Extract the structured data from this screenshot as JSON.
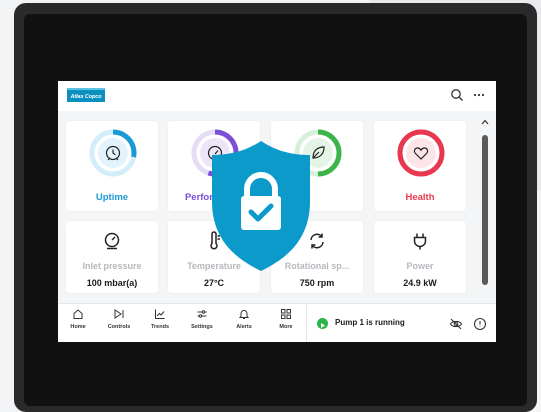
{
  "brand": {
    "logo_text": "Atlas Copco",
    "accent": "#0b8fbf"
  },
  "header": {
    "search_icon": "search-icon",
    "more_icon": "more-horizontal-icon"
  },
  "big_cards": [
    {
      "label": "Uptime",
      "icon": "clock-icon",
      "color": "#1a9bd7",
      "progress": 0.28
    },
    {
      "label": "Performance",
      "icon": "gauge-icon",
      "color": "#7b4fd6",
      "progress": 0.55
    },
    {
      "label": "",
      "icon": "leaf-icon",
      "color": "#3cb44a",
      "progress": 0.5
    },
    {
      "label": "Health",
      "icon": "heart-icon",
      "color": "#e8384f",
      "progress": 1.0
    }
  ],
  "kpi_cards": [
    {
      "label": "Inlet pressure",
      "value": "100 mbar(a)",
      "icon": "pressure-gauge-icon"
    },
    {
      "label": "Temperature",
      "value": "27°C",
      "icon": "thermometer-icon"
    },
    {
      "label": "Rotational sp...",
      "value": "750 rpm",
      "icon": "rotation-icon"
    },
    {
      "label": "Power",
      "value": "24.9 kW",
      "icon": "plug-icon"
    }
  ],
  "nav": [
    {
      "label": "Home",
      "icon": "home-icon"
    },
    {
      "label": "Controls",
      "icon": "controls-icon"
    },
    {
      "label": "Trends",
      "icon": "trend-chart-icon"
    },
    {
      "label": "Settings",
      "icon": "sliders-icon"
    },
    {
      "label": "Alerts",
      "icon": "bell-icon"
    },
    {
      "label": "More",
      "icon": "grid-icon"
    }
  ],
  "status": {
    "text": "Pump 1 is running",
    "color": "#2bb44a"
  }
}
